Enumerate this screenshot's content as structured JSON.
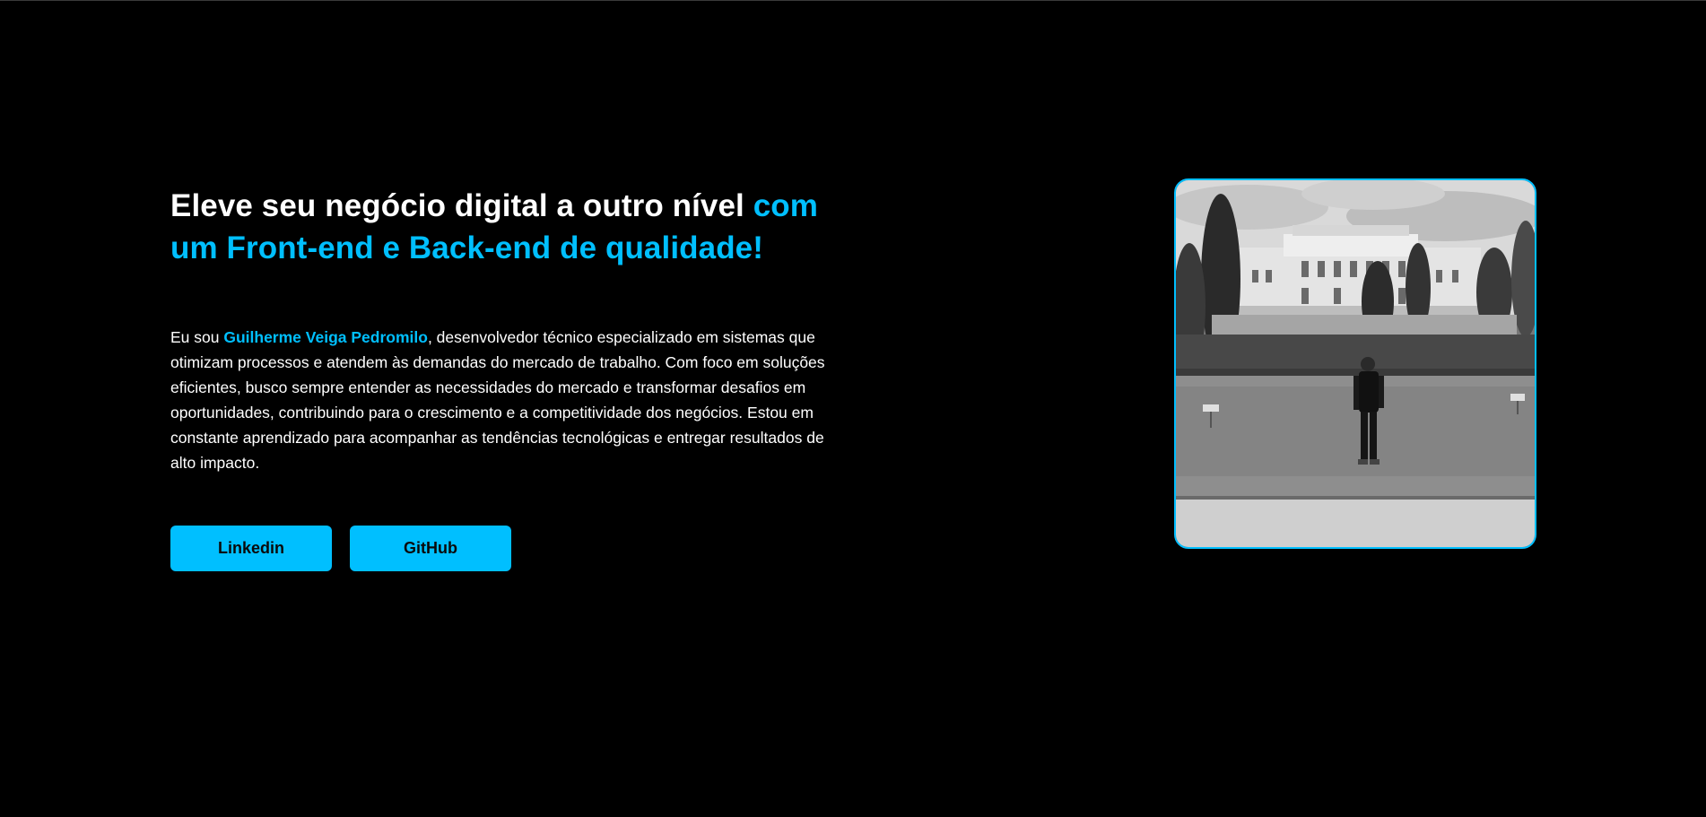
{
  "hero": {
    "headline_white": "Eleve seu negócio digital a outro nível ",
    "headline_accent": "com um Front-end e Back-end de qualidade!",
    "bio_prefix": "Eu sou ",
    "bio_name": "Guilherme Veiga Pedromilo",
    "bio_text": ", desenvolvedor técnico especializado em sistemas que otimizam processos e atendem às demandas do mercado de trabalho. Com foco em soluções eficientes, busco sempre entender as necessidades do mercado e transformar desafios em oportunidades, contribuindo para o crescimento e a competitividade dos negócios. Estou em constante aprendizado para acompanhar as tendências tecnológicas e entregar resultados de alto impacto."
  },
  "buttons": {
    "linkedin_label": "Linkedin",
    "github_label": "GitHub"
  },
  "colors": {
    "background": "#000000",
    "accent": "#00bfff",
    "text": "#ffffff"
  }
}
